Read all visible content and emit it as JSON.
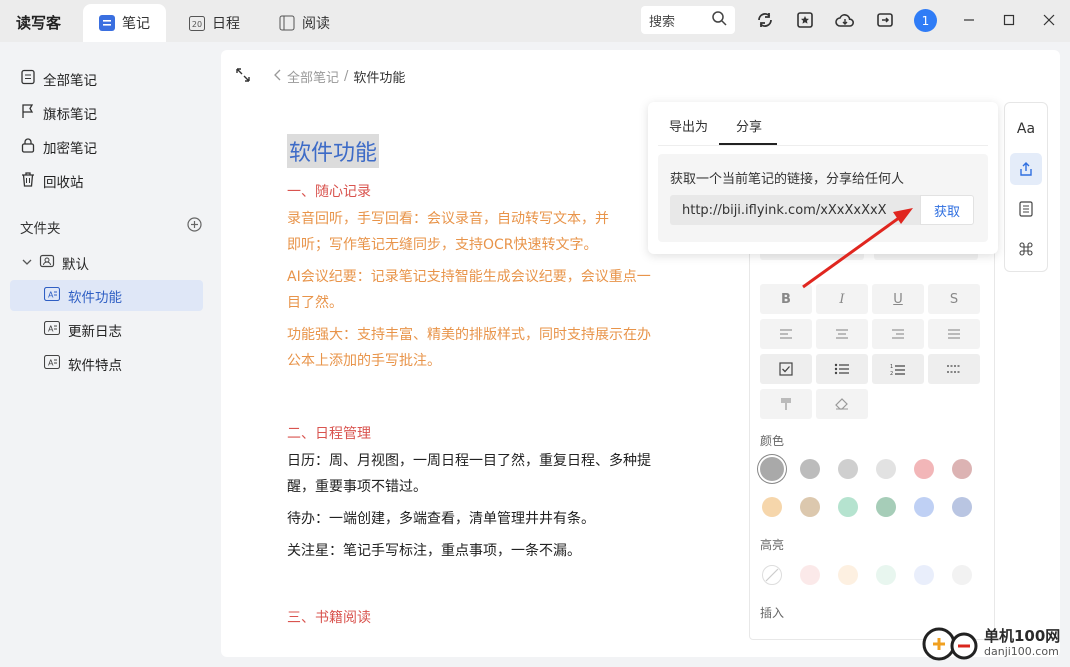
{
  "app": {
    "name": "读写客"
  },
  "tabs": [
    {
      "label": "笔记",
      "icon": "note-icon"
    },
    {
      "label": "日程",
      "icon": "calendar-icon",
      "icon_text": "20"
    },
    {
      "label": "阅读",
      "icon": "book-icon"
    }
  ],
  "search": {
    "label": "搜索"
  },
  "avatar": {
    "text": "1"
  },
  "sidebar": {
    "items": [
      {
        "label": "全部笔记",
        "icon": "notes-icon"
      },
      {
        "label": "旗标笔记",
        "icon": "flag-icon"
      },
      {
        "label": "加密笔记",
        "icon": "lock-icon"
      },
      {
        "label": "回收站",
        "icon": "trash-icon"
      }
    ],
    "folder_header": "文件夹",
    "default_folder": "默认",
    "notes": [
      {
        "label": "软件功能",
        "active": true
      },
      {
        "label": "更新日志",
        "active": false
      },
      {
        "label": "软件特点",
        "active": false
      }
    ]
  },
  "breadcrumb": {
    "parent": "全部笔记",
    "separator": "/",
    "current": "软件功能"
  },
  "doc": {
    "title": "软件功能",
    "s1_heading": "一、随心记录",
    "s1_p1": "录音回听，手写回看：会议录音，自动转写文本，并",
    "s1_p1b": "即听；写作笔记无缝同步，支持OCR快速转文字。",
    "s1_p2": "AI会议纪要：记录笔记支持智能生成会议纪要，会议重点一",
    "s1_p2b": "目了然。",
    "s1_p3": "功能强大：支持丰富、精美的排版样式，同时支持展示在办",
    "s1_p3b": "公本上添加的手写批注。",
    "s2_heading": "二、日程管理",
    "s2_p1": "日历：周、月视图，一周日程一目了然，重复日程、多种提",
    "s2_p1b": "醒，重要事项不错过。",
    "s2_p2": "待办：一端创建，多端查看，清单管理井井有条。",
    "s2_p3": "关注星：笔记手写标注，重点事项，一条不漏。",
    "s3_heading": "三、书籍阅读"
  },
  "format_panel": {
    "color_label": "颜色",
    "highlight_label": "高亮",
    "insert_label": "插入",
    "text_colors": [
      "#a9a9a9",
      "#bcbcbc",
      "#cfcfcf",
      "#e2e2e2",
      "#f2b6b8",
      "#dcb3b3",
      "#f6d6ab",
      "#dcc8ae",
      "#b5e3cf",
      "#a6cdb8",
      "#bfd0f4",
      "#b9c5e2"
    ],
    "highlight_colors": [
      "#fbe9e9",
      "#fdf0e1",
      "#e8f6ef",
      "#e9eefb",
      "#f2f2f2"
    ]
  },
  "share_popup": {
    "tab_export": "导出为",
    "tab_share": "分享",
    "description": "获取一个当前笔记的链接，分享给任何人",
    "link": "http://biji.iflyink.com/xXxXxXxX",
    "get_button": "获取"
  },
  "right_bar": {
    "font_label": "Aa"
  },
  "watermark": {
    "line1": "单机100网",
    "line2": "danji100.com"
  }
}
